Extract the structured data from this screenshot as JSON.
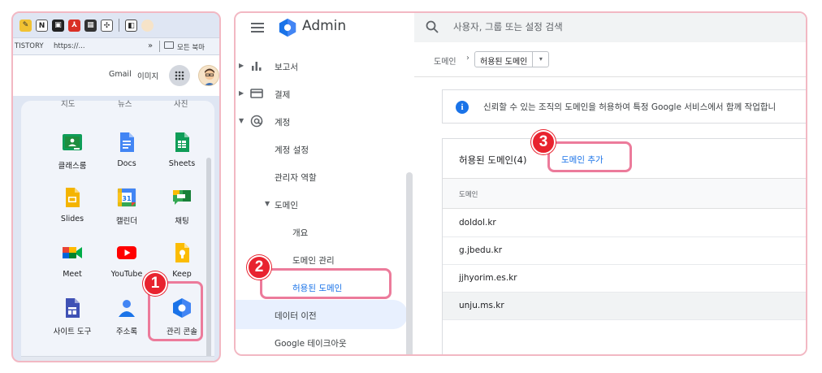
{
  "left": {
    "bookmarks": {
      "tistory": "TISTORY",
      "url": "https://...",
      "more": "»",
      "all": "모든 북마"
    },
    "header": {
      "gmail": "Gmail",
      "images": "이미지"
    },
    "cut_labels": [
      "지도",
      "뉴스",
      "사진"
    ],
    "apps": [
      {
        "label": "클래스룸",
        "icon": "classroom-icon"
      },
      {
        "label": "Docs",
        "icon": "docs-icon"
      },
      {
        "label": "Sheets",
        "icon": "sheets-icon"
      },
      {
        "label": "Slides",
        "icon": "slides-icon"
      },
      {
        "label": "캘린더",
        "icon": "calendar-icon"
      },
      {
        "label": "채팅",
        "icon": "chat-icon"
      },
      {
        "label": "Meet",
        "icon": "meet-icon"
      },
      {
        "label": "YouTube",
        "icon": "youtube-icon"
      },
      {
        "label": "Keep",
        "icon": "keep-icon"
      },
      {
        "label": "사이트 도구",
        "icon": "sites-icon"
      },
      {
        "label": "주소록",
        "icon": "contacts-icon"
      },
      {
        "label": "관리 콘솔",
        "icon": "admin-console-icon"
      }
    ],
    "calendar_day": "31"
  },
  "steps": {
    "one": "1",
    "two": "2",
    "three": "3"
  },
  "admin": {
    "title": "Admin",
    "search_placeholder": "사용자, 그룹 또는 설정 검색",
    "nav": {
      "reports": "보고서",
      "billing": "결제",
      "account": "계정",
      "account_settings": "계정 설정",
      "admin_roles": "관리자 역할",
      "domains": "도메인",
      "overview": "개요",
      "manage_domains": "도메인 관리",
      "allowlisted_domains": "허용된 도메인",
      "data_migration": "데이터 이전",
      "takeout": "Google 테이크아웃"
    },
    "breadcrumb": {
      "root": "도메인",
      "sep": "›",
      "current": "허용된 도메인",
      "dropdown": "▾"
    },
    "info": "신뢰할 수 있는 조직의 도메인을 허용하여 특정 Google 서비스에서 함께 작업합니",
    "card": {
      "title": "허용된 도메인(4)",
      "add_button": "도메인 추가",
      "column": "도메인",
      "rows": [
        "doldol.kr",
        "g.jbedu.kr",
        "jjhyorim.es.kr",
        "unju.ms.kr"
      ]
    }
  },
  "colors": {
    "highlight": "#ec7b9b",
    "step_badge": "#e8232f",
    "link": "#1a73e8",
    "active_nav": "#e8f0fe"
  }
}
